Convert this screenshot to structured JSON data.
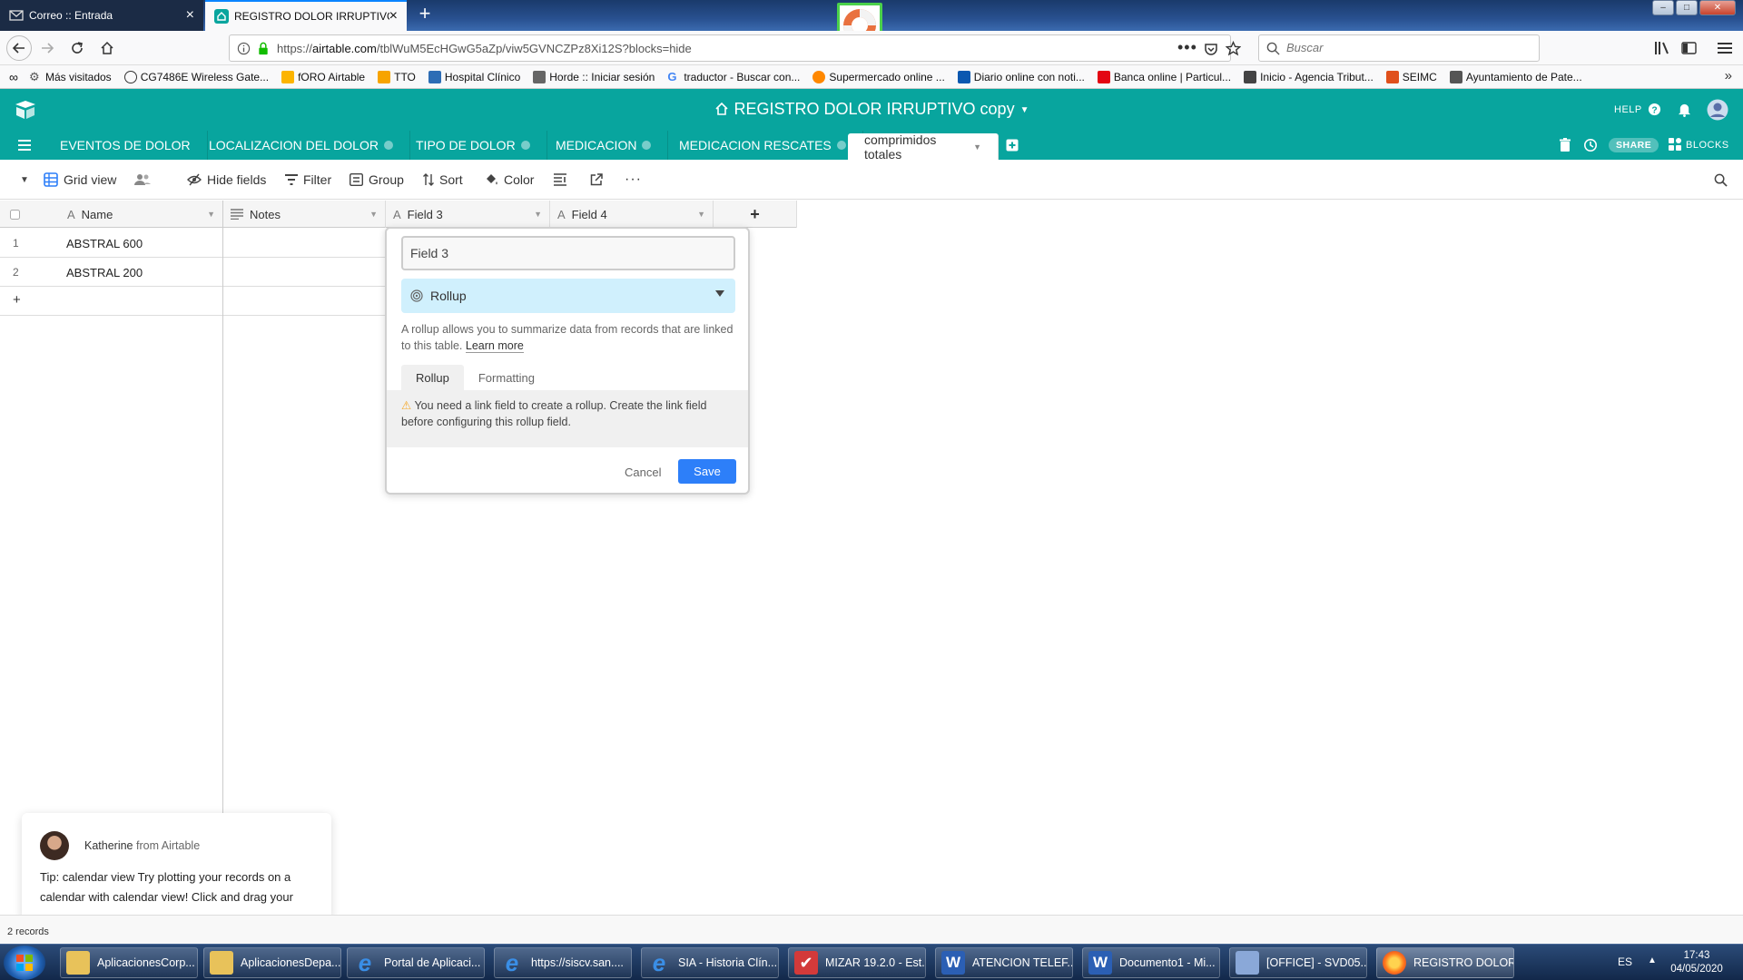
{
  "browser": {
    "tabs": [
      {
        "label": "Correo :: Entrada"
      },
      {
        "label": "REGISTRO DOLOR IRRUPTIVO c"
      }
    ],
    "url_prefix": "https://",
    "url_domain": "airtable.com",
    "url_path": "/tblWuM5EcHGwG5aZp/viw5GVNCZPz8Xi12S?blocks=hide",
    "search_placeholder": "Buscar",
    "bookmarks": [
      {
        "label": "Más visitados",
        "color": "#555555"
      },
      {
        "label": "CG7486E Wireless Gate...",
        "color": "#333333"
      },
      {
        "label": "fORO Airtable",
        "color": "#fcb400"
      },
      {
        "label": "TTO",
        "color": "#f7a400"
      },
      {
        "label": "Hospital Clínico",
        "color": "#2d6db5"
      },
      {
        "label": "Horde :: Iniciar sesión",
        "color": "#666666"
      },
      {
        "label": "traductor - Buscar con...",
        "color": "#4285f4"
      },
      {
        "label": "Supermercado online ...",
        "color": "#ff8800"
      },
      {
        "label": "Diario online con noti...",
        "color": "#0b58b0"
      },
      {
        "label": "Banca online | Particul...",
        "color": "#e30613"
      },
      {
        "label": "Inicio - Agencia Tribut...",
        "color": "#444444"
      },
      {
        "label": "SEIMC",
        "color": "#e0501c"
      },
      {
        "label": "Ayuntamiento de Pate...",
        "color": "#555555"
      }
    ]
  },
  "airtable": {
    "base_title": "REGISTRO DOLOR IRRUPTIVO copy",
    "help": "HELP",
    "share": "SHARE",
    "blocks": "BLOCKS",
    "tables": [
      {
        "label": "EVENTOS DE DOLOR"
      },
      {
        "label": "LOCALIZACION DEL DOLOR"
      },
      {
        "label": "TIPO DE DOLOR"
      },
      {
        "label": "MEDICACION"
      },
      {
        "label": "MEDICACION RESCATES"
      },
      {
        "label": "comprimidos totales"
      }
    ],
    "toolbar": {
      "view": "Grid view",
      "hide_fields": "Hide fields",
      "filter": "Filter",
      "group": "Group",
      "sort": "Sort",
      "color": "Color"
    },
    "columns": [
      {
        "label": "Name"
      },
      {
        "label": "Notes"
      },
      {
        "label": "Field 3"
      },
      {
        "label": "Field 4"
      }
    ],
    "rows": [
      {
        "num": "1",
        "name": "ABSTRAL 600"
      },
      {
        "num": "2",
        "name": "ABSTRAL 200"
      }
    ],
    "add_row": "+",
    "add_column": "+",
    "records_count": "2 records"
  },
  "dialog": {
    "field_name": "Field 3",
    "field_type": "Rollup",
    "description": "A rollup allows you to summarize data from records that are linked to this table.",
    "learn_more": "Learn more",
    "tabs": [
      "Rollup",
      "Formatting"
    ],
    "warning": "You need a link field to create a rollup. Create the link field before configuring this rollup field.",
    "cancel": "Cancel",
    "save": "Save"
  },
  "chat": {
    "sender": "Katherine",
    "from": "from Airtable",
    "message": "Tip: calendar view Try plotting your records on a calendar with calendar view! Click and drag your"
  },
  "taskbar": {
    "items": [
      {
        "label": "AplicacionesCorp...",
        "color": "#e8c25a"
      },
      {
        "label": "AplicacionesDepa...",
        "color": "#e8c25a"
      },
      {
        "label": "Portal de Aplicaci...",
        "color": "#3a8ee6"
      },
      {
        "label": "https://siscv.san....",
        "color": "#3a8ee6"
      },
      {
        "label": "SIA - Historia Clín...",
        "color": "#3a8ee6"
      },
      {
        "label": "MIZAR 19.2.0 - Est...",
        "color": "#d33a3a"
      },
      {
        "label": "ATENCION TELEF...",
        "color": "#2b5fb4"
      },
      {
        "label": "Documento1 - Mi...",
        "color": "#2b5fb4"
      },
      {
        "label": "[OFFICE] - SVD05...",
        "color": "#8aa8d8"
      },
      {
        "label": "REGISTRO DOLOR...",
        "color": "#ff7b1c"
      }
    ],
    "lang": "ES",
    "time": "17:43",
    "date": "04/05/2020"
  }
}
